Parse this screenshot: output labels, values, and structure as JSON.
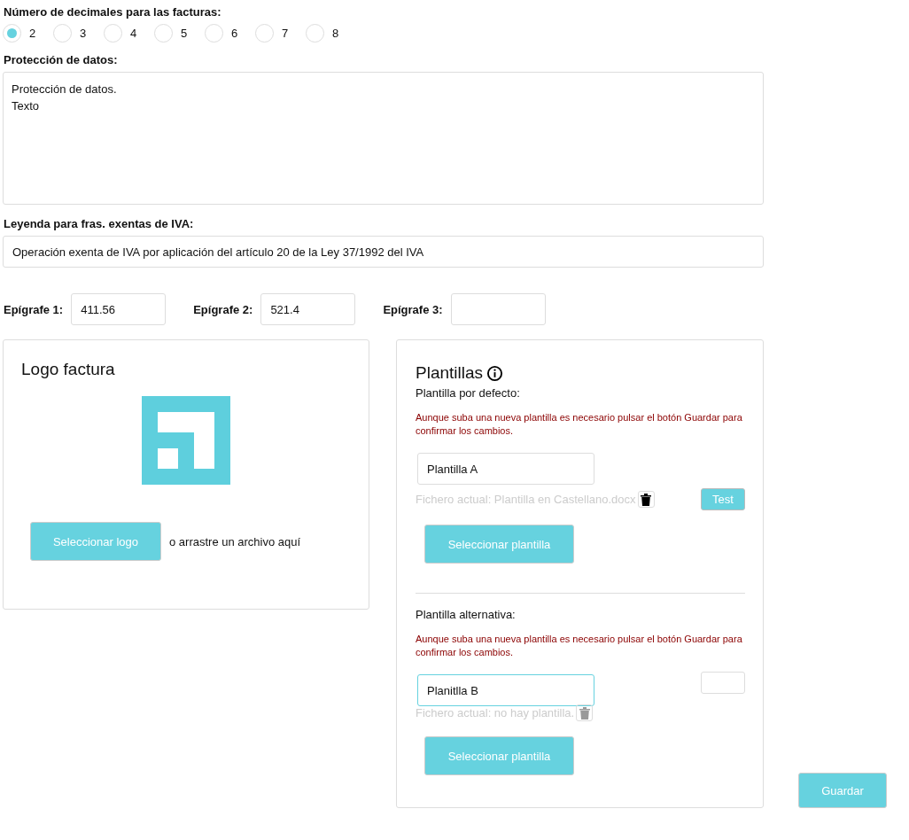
{
  "decimals": {
    "label": "Número de decimales para las facturas:",
    "options": [
      {
        "label": "2",
        "selected": true
      },
      {
        "label": "3",
        "selected": false
      },
      {
        "label": "4",
        "selected": false
      },
      {
        "label": "5",
        "selected": false
      },
      {
        "label": "6",
        "selected": false
      },
      {
        "label": "7",
        "selected": false
      },
      {
        "label": "8",
        "selected": false
      }
    ]
  },
  "data_protection": {
    "label": "Protección de datos:",
    "value": "Protección de datos.\nTexto"
  },
  "vat_exempt": {
    "label": "Leyenda para fras. exentas de IVA:",
    "value": "Operación exenta de IVA por aplicación del artículo 20 de la Ley 37/1992 del IVA"
  },
  "epigraphs": [
    {
      "label": "Epígrafe 1:",
      "value": "411.56"
    },
    {
      "label": "Epígrafe 2:",
      "value": "521.4"
    },
    {
      "label": "Epígrafe 3:"
    }
  ],
  "logo_card": {
    "title": "Logo factura",
    "button": "Seleccionar logo",
    "hint": "o arrastre un archivo aquí"
  },
  "templates_card": {
    "title": "Plantillas",
    "templates": [
      {
        "label": "Plantilla por defecto:",
        "note": "Aunque suba una nueva plantilla es necesario pulsar el botón Guardar para confirmar los cambios.",
        "value": "Plantilla A",
        "focused": false,
        "file": "Fichero actual: Plantilla en Castellano.docx",
        "delete_disabled": false,
        "side": {
          "kind": "button",
          "label": "Test"
        },
        "button": "Seleccionar plantilla"
      },
      {
        "label": "Plantilla alternativa:",
        "note": "Aunque suba una nueva plantilla es necesario pulsar el botón Guardar para confirmar los cambios.",
        "value": "Planitlla B",
        "focused": true,
        "file": "Fichero actual: no hay plantilla.",
        "delete_disabled": true,
        "side": {
          "kind": "field"
        },
        "button": "Seleccionar plantilla"
      }
    ]
  },
  "save_button": "Guardar"
}
